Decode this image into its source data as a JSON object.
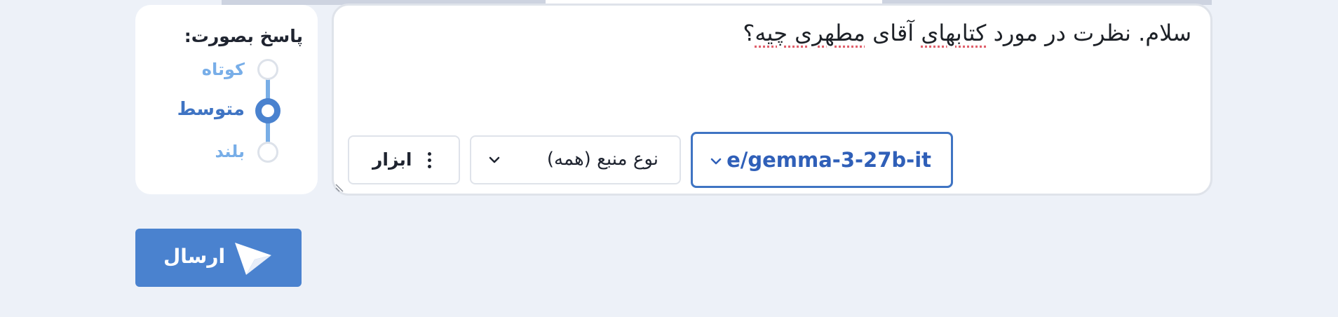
{
  "response_length": {
    "title": "پاسخ بصورت:",
    "options": [
      {
        "label": "کوتاه",
        "selected": false
      },
      {
        "label": "متوسط",
        "selected": true
      },
      {
        "label": "بلند",
        "selected": false
      }
    ]
  },
  "query": {
    "text_before": "سلام. نظرت در مورد ",
    "misspelled_1": "کتابهای",
    "text_mid": " آقای ",
    "misspelled_2": "مطهری چیه",
    "text_after": "؟"
  },
  "toolbar": {
    "tools_label": "ابزار",
    "source_type_label": "نوع منبع (همه)",
    "model_label": "e/gemma-3-27b-it"
  },
  "send_button": {
    "label": "ارسال"
  },
  "colors": {
    "accent": "#4a82cf",
    "accent_dark": "#3f74c3",
    "background": "#edf1f8",
    "card": "#ffffff",
    "muted_option": "#78aee8"
  },
  "icons": {
    "tools": "kebab-icon",
    "source_type": "chevron-down-icon",
    "model": "chevron-down-icon",
    "send": "send-icon"
  }
}
